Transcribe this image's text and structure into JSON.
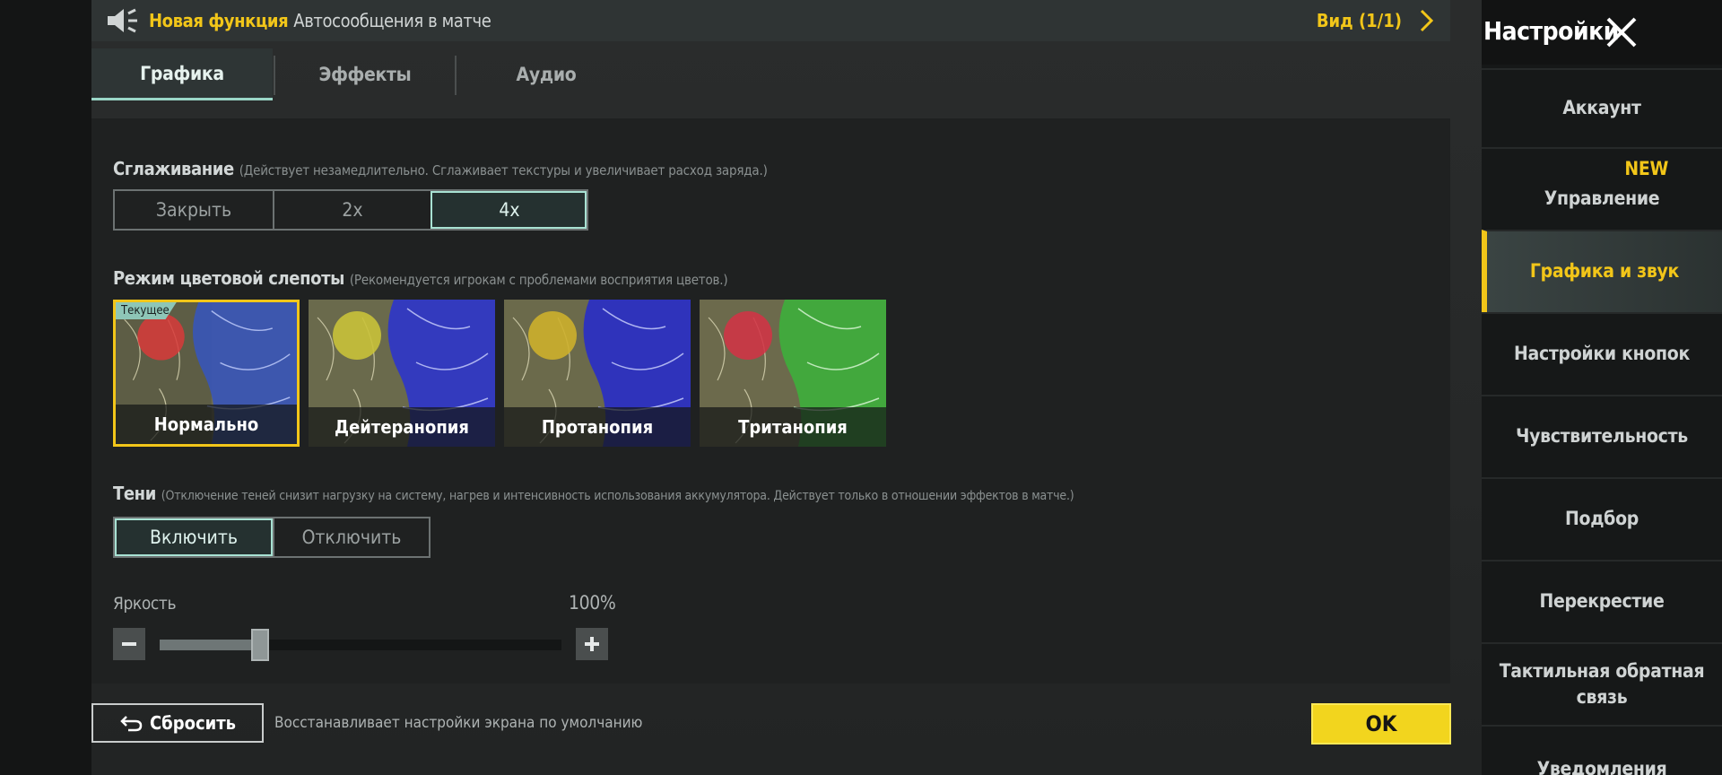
{
  "topbar": {
    "new_label": "Новая функция",
    "message": "Автосообщения в матче",
    "view_label": "Вид (1/1)"
  },
  "tabs": [
    {
      "label": "Графика",
      "active": true
    },
    {
      "label": "Эффекты",
      "active": false
    },
    {
      "label": "Аудио",
      "active": false
    }
  ],
  "antialiasing": {
    "title": "Сглаживание",
    "note": "(Действует незамедлительно. Сглаживает текстуры и увеличивает расход заряда.)",
    "options": [
      "Закрыть",
      "2x",
      "4x"
    ],
    "selected": "4x"
  },
  "colorblind": {
    "title": "Режим цветовой слепоты",
    "note": "(Рекомендуется игрокам с проблемами восприятия цветов.)",
    "current_badge": "Текущее",
    "modes": [
      {
        "label": "Нормально",
        "circle_color": "#d83a3a",
        "zone_color": "#3755b8",
        "selected": true
      },
      {
        "label": "Дейтеранопия",
        "circle_color": "#c9c23a",
        "zone_color": "#2f36c8",
        "selected": false
      },
      {
        "label": "Протанопия",
        "circle_color": "#cdb02c",
        "zone_color": "#2a2fc4",
        "selected": false
      },
      {
        "label": "Тританопия",
        "circle_color": "#d23346",
        "zone_color": "#3fae3c",
        "selected": false
      }
    ]
  },
  "shadows": {
    "title": "Тени",
    "note": "(Отключение теней снизит нагрузку на систему, нагрев и интенсивность использования аккумулятора. Действует только в отношении эффектов в матче.)",
    "options": [
      "Включить",
      "Отключить"
    ],
    "selected": "Включить"
  },
  "brightness": {
    "title": "Яркость",
    "value_text": "100%",
    "level": 0.25
  },
  "footer": {
    "reset_label": "Сбросить",
    "reset_note": "Восстанавливает настройки экрана по умолчанию",
    "ok_label": "OK"
  },
  "sidebar": {
    "title": "Настройки",
    "new_badge": "NEW",
    "items": [
      {
        "label": "Аккаунт"
      },
      {
        "label": "Управление"
      },
      {
        "label": "Графика и звук"
      },
      {
        "label": "Настройки кнопок"
      },
      {
        "label": "Чувствительность"
      },
      {
        "label": "Подбор"
      },
      {
        "label": "Перекрестие"
      },
      {
        "label": "Тактильная обратная связь"
      },
      {
        "label": "Уведомления"
      }
    ]
  },
  "colors": {
    "accent_yellow": "#f2c619",
    "accent_teal": "#9ad6c7"
  }
}
